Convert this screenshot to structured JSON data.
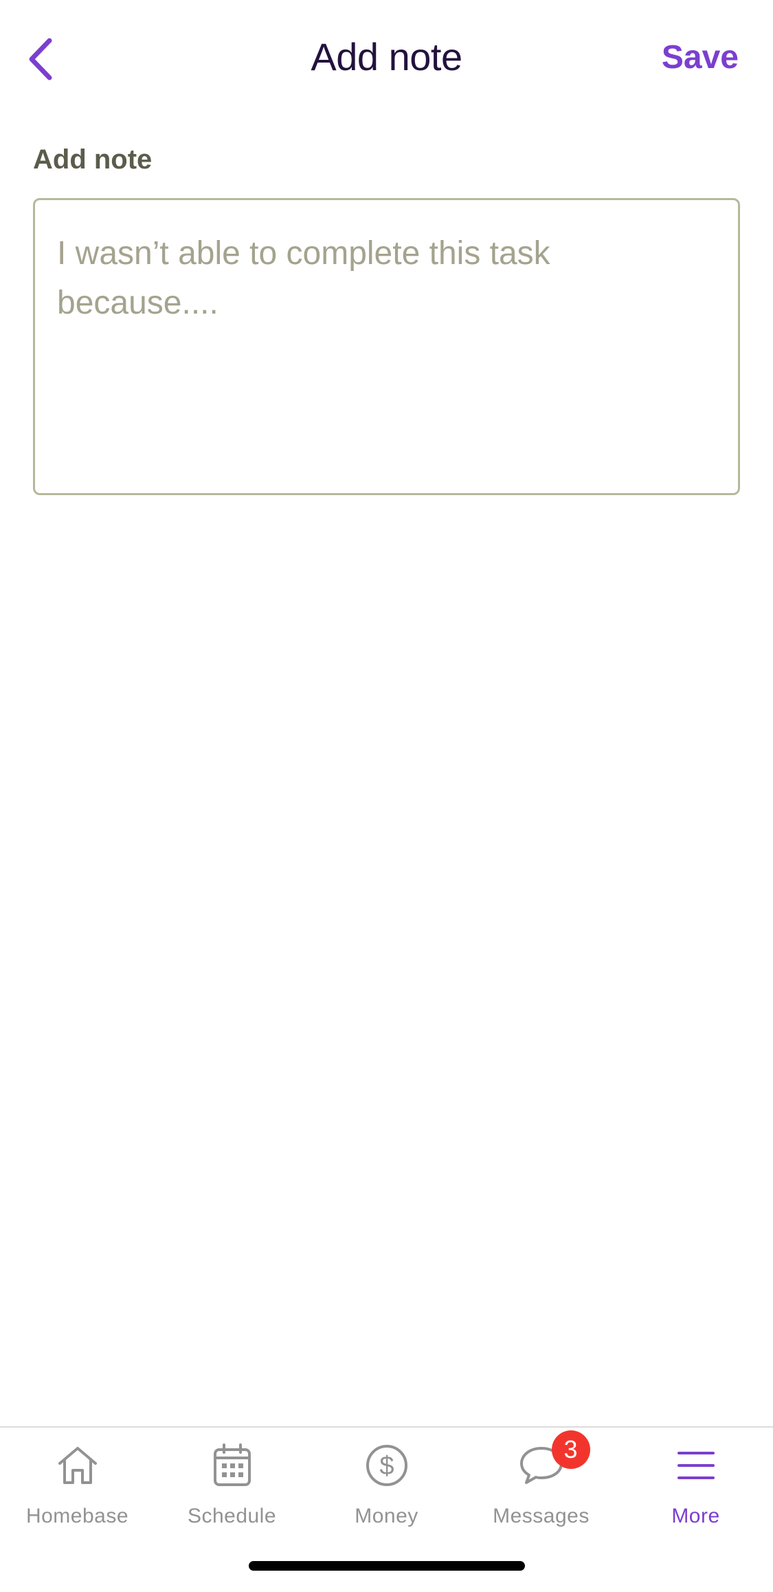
{
  "header": {
    "title": "Add note",
    "save_label": "Save"
  },
  "note_field": {
    "label": "Add note",
    "placeholder": "I wasn’t able to complete this task because....",
    "value": ""
  },
  "tab_bar": {
    "active": "More",
    "tabs": [
      {
        "label": "Homebase",
        "icon": "house-icon"
      },
      {
        "label": "Schedule",
        "icon": "calendar-icon"
      },
      {
        "label": "Money",
        "icon": "dollar-icon"
      },
      {
        "label": "Messages",
        "icon": "chat-bubble-icon",
        "badge": "3"
      },
      {
        "label": "More",
        "icon": "menu-icon"
      }
    ]
  },
  "colors": {
    "accent": "#7b3fcf",
    "title": "#23123d",
    "label": "#5c5c4c",
    "placeholder": "#a4a38e",
    "field_border": "#b7b89a",
    "tab_inactive": "#929292",
    "badge": "#f2352c"
  }
}
